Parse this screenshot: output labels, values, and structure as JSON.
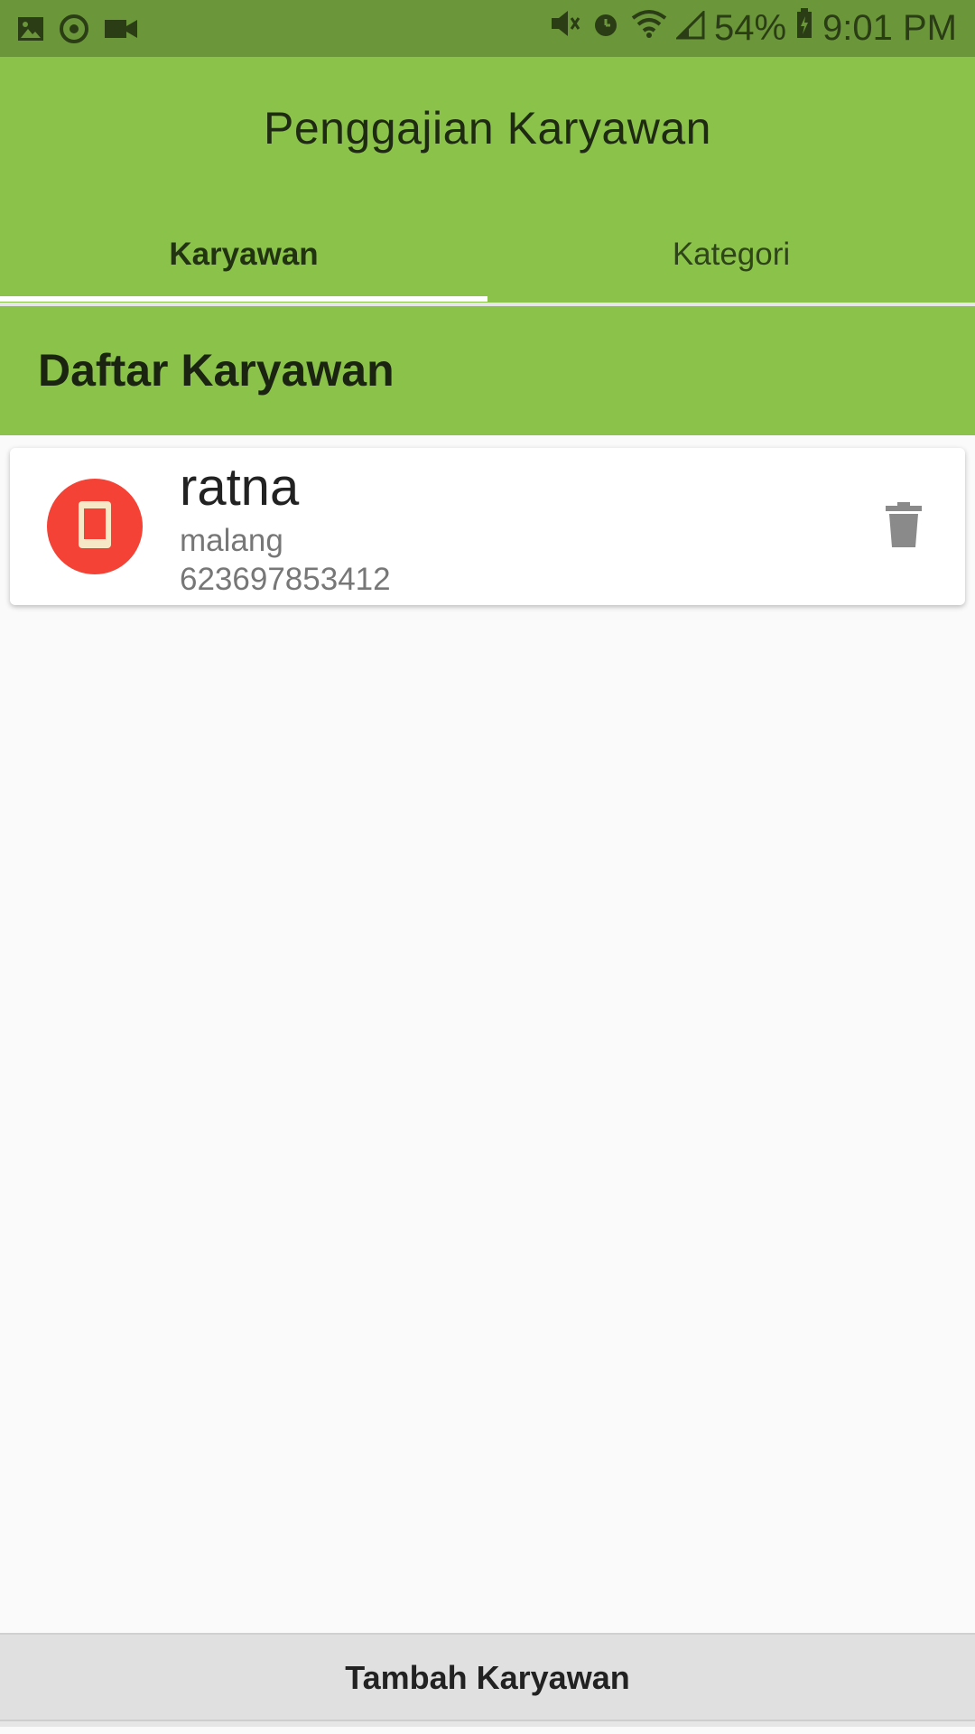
{
  "status_bar": {
    "battery": "54%",
    "time": "9:01 PM"
  },
  "app_bar": {
    "title": "Penggajian Karyawan",
    "tabs": [
      {
        "label": "Karyawan",
        "selected": true
      },
      {
        "label": "Kategori",
        "selected": false
      }
    ]
  },
  "section": {
    "title": "Daftar Karyawan"
  },
  "employees": [
    {
      "name": "ratna",
      "city": "malang",
      "phone": "623697853412",
      "avatar_color": "#f44336",
      "icon": "phone-icon"
    }
  ],
  "actions": {
    "add_label": "Tambah Karyawan"
  },
  "colors": {
    "primary": "#8bc34a",
    "status_bar": "#6b963a",
    "avatar": "#f44336",
    "background": "#fafafa"
  }
}
